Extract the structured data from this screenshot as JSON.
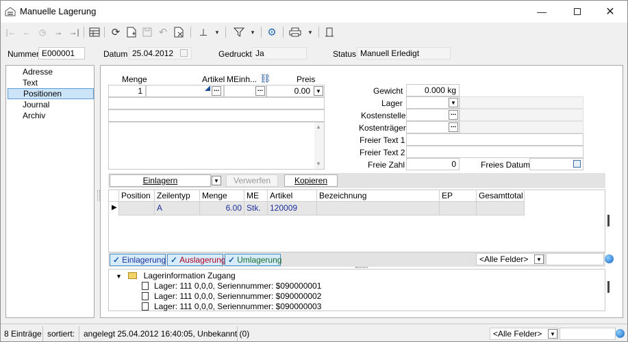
{
  "window": {
    "title": "Manuelle Lagerung"
  },
  "header": {
    "nummer_label": "Nummer",
    "nummer_value": "E000001",
    "datum_label": "Datum",
    "datum_value": "25.04.2012",
    "gedruckt_label": "Gedruckt",
    "gedruckt_value": "Ja",
    "status_label": "Status",
    "status_value": "Manuell Erledigt"
  },
  "nav": {
    "items": [
      "Adresse",
      "Text",
      "Positionen",
      "Journal",
      "Archiv"
    ],
    "selected": "Positionen"
  },
  "entry": {
    "menge_label": "Menge",
    "artikel_label": "Artikel",
    "meinh_label": "MEinh...",
    "preis_label": "Preis",
    "menge_value": "1",
    "preis_value": "0.00"
  },
  "right_fields": {
    "gewicht_label": "Gewicht",
    "gewicht_value": "0.000",
    "gewicht_unit": "kg",
    "lager_label": "Lager",
    "kostenstelle_label": "Kostenstelle",
    "kostentraeger_label": "Kostenträger",
    "freier_text1_label": "Freier Text 1",
    "freier_text2_label": "Freier Text 2",
    "freie_zahl_label": "Freie Zahl",
    "freie_zahl_value": "0",
    "freies_datum_label": "Freies Datum"
  },
  "actions": {
    "einlagern": "Einlagern",
    "verwerfen": "Verwerfen",
    "kopieren": "Kopieren"
  },
  "grid": {
    "columns": [
      "Position",
      "Zeilentyp",
      "Menge",
      "ME",
      "Artikel",
      "Bezeichnung",
      "EP",
      "Gesamttotal"
    ],
    "rows": [
      {
        "position": "",
        "zeilentyp": "A",
        "menge": "6.00",
        "me": "Stk.",
        "artikel": "120009",
        "bezeichnung": "",
        "ep": "",
        "gesamttotal": ""
      }
    ]
  },
  "filters": {
    "einlagerung": "Einlagerung",
    "auslagerung": "Auslagerung",
    "umlagerung": "Umlagerung",
    "alle_felder": "<Alle Felder>"
  },
  "tree": {
    "root": "Lagerinformation Zugang",
    "children": [
      "Lager: 111 0,0,0, Seriennummer: $090000001",
      "Lager: 111 0,0,0, Seriennummer: $090000002",
      "Lager: 111 0,0,0, Seriennummer: $090000003"
    ]
  },
  "statusbar": {
    "count": "8 Einträge",
    "sorted": "sortiert:",
    "created": "angelegt 25.04.2012 16:40:05, Unbekannt (0)",
    "alle_felder": "<Alle Felder>"
  }
}
